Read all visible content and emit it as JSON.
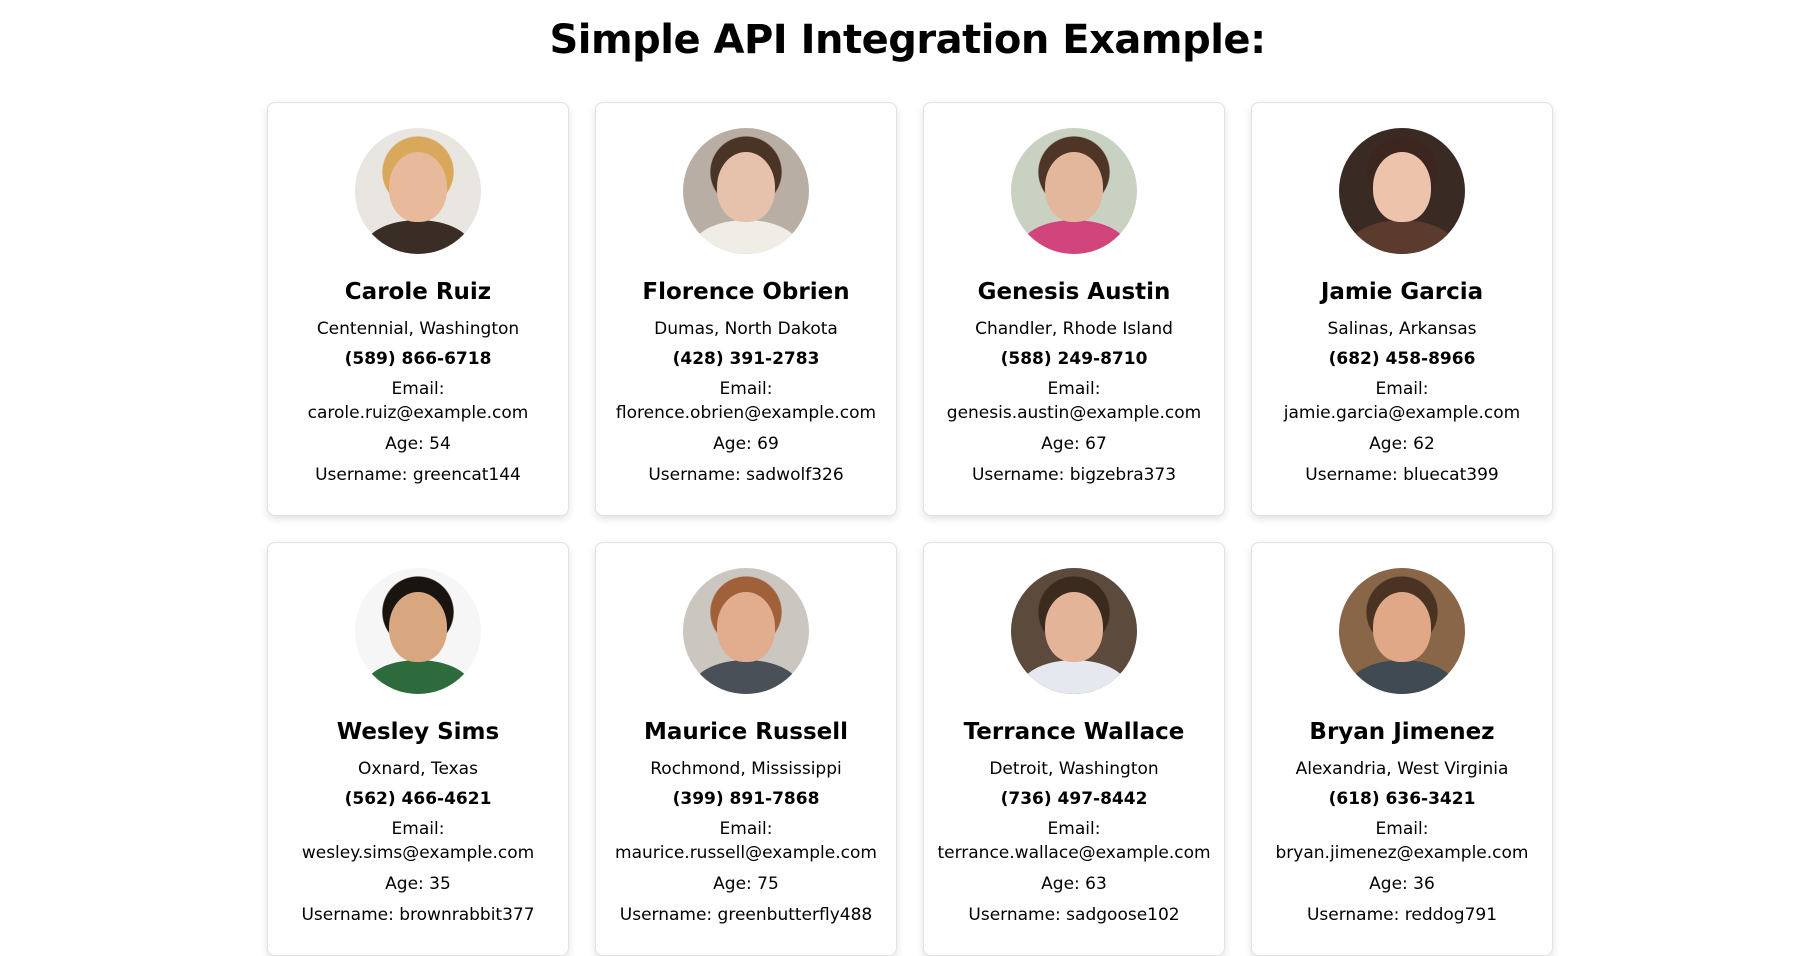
{
  "page": {
    "title": "Simple API Integration Example:"
  },
  "users": [
    {
      "name": "Carole Ruiz",
      "location": "Centennial, Washington",
      "phone": "(589) 866-6718",
      "email_label": "Email:",
      "email": "carole.ruiz@example.com",
      "age": "Age: 54",
      "username": "Username: greencat144",
      "avatar_colors": {
        "bg": "#e9e6e1",
        "head": "#e8b99a",
        "shoulders": "#3a2d26",
        "hair": "#d9a85a"
      }
    },
    {
      "name": "Florence Obrien",
      "location": "Dumas, North Dakota",
      "phone": "(428) 391-2783",
      "email_label": "Email:",
      "email": "florence.obrien@example.com",
      "age": "Age: 69",
      "username": "Username: sadwolf326",
      "avatar_colors": {
        "bg": "#b9aea4",
        "head": "#e6c2ad",
        "shoulders": "#f0ece6",
        "hair": "#4a3426"
      }
    },
    {
      "name": "Genesis Austin",
      "location": "Chandler, Rhode Island",
      "phone": "(588) 249-8710",
      "email_label": "Email:",
      "email": "genesis.austin@example.com",
      "age": "Age: 67",
      "username": "Username: bigzebra373",
      "avatar_colors": {
        "bg": "#c9d1c3",
        "head": "#e2b79c",
        "shoulders": "#d2457c",
        "hair": "#4e3526"
      }
    },
    {
      "name": "Jamie Garcia",
      "location": "Salinas, Arkansas",
      "phone": "(682) 458-8966",
      "email_label": "Email:",
      "email": "jamie.garcia@example.com",
      "age": "Age: 62",
      "username": "Username: bluecat399",
      "avatar_colors": {
        "bg": "#3a2a24",
        "head": "#edc3ab",
        "shoulders": "#5a3b2e",
        "hair": "#3d2620"
      }
    },
    {
      "name": "Wesley Sims",
      "location": "Oxnard, Texas",
      "phone": "(562) 466-4621",
      "email_label": "Email:",
      "email": "wesley.sims@example.com",
      "age": "Age: 35",
      "username": "Username: brownrabbit377",
      "avatar_colors": {
        "bg": "#f6f6f6",
        "head": "#d8a67f",
        "shoulders": "#2e6b3c",
        "hair": "#1a1410"
      }
    },
    {
      "name": "Maurice Russell",
      "location": "Rochmond, Mississippi",
      "phone": "(399) 891-7868",
      "email_label": "Email:",
      "email": "maurice.russell@example.com",
      "age": "Age: 75",
      "username": "Username: greenbutterfly488",
      "avatar_colors": {
        "bg": "#cbc6c0",
        "head": "#e2ad8f",
        "shoulders": "#4a5058",
        "hair": "#a0603a"
      }
    },
    {
      "name": "Terrance Wallace",
      "location": "Detroit, Washington",
      "phone": "(736) 497-8442",
      "email_label": "Email:",
      "email": "terrance.wallace@example.com",
      "age": "Age: 63",
      "username": "Username: sadgoose102",
      "avatar_colors": {
        "bg": "#5c4a3c",
        "head": "#e4b498",
        "shoulders": "#e6e8f0",
        "hair": "#3b2a1e"
      }
    },
    {
      "name": "Bryan Jimenez",
      "location": "Alexandria, West Virginia",
      "phone": "(618) 636-3421",
      "email_label": "Email:",
      "email": "bryan.jimenez@example.com",
      "age": "Age: 36",
      "username": "Username: reddog791",
      "avatar_colors": {
        "bg": "#8a6648",
        "head": "#e0a886",
        "shoulders": "#3f4a52",
        "hair": "#4a3322"
      }
    }
  ]
}
